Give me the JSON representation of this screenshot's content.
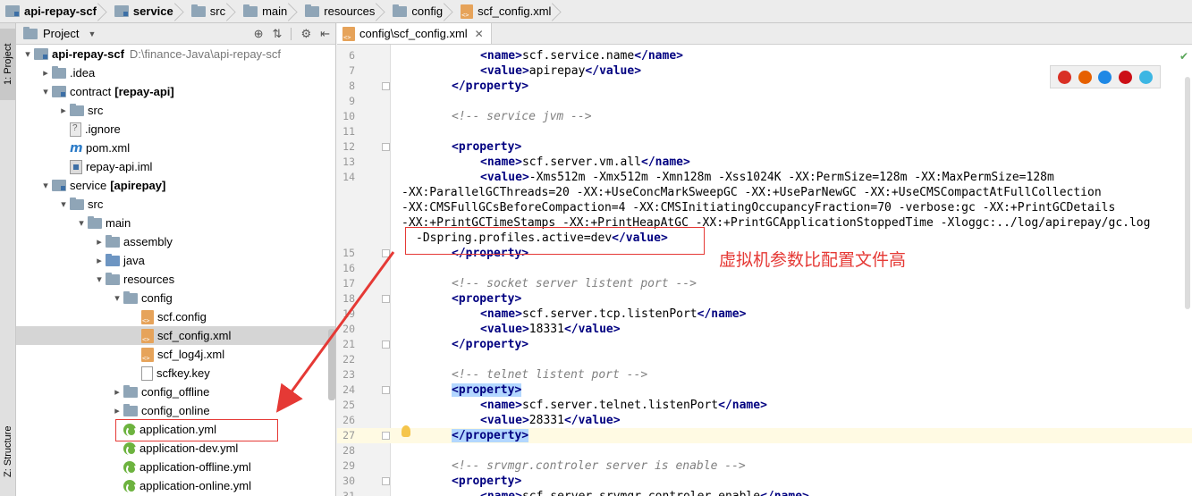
{
  "breadcrumb": [
    {
      "label": "api-repay-scf",
      "icon": "module-icon",
      "bold": true
    },
    {
      "label": "service",
      "icon": "module-icon",
      "bold": true
    },
    {
      "label": "src",
      "icon": "folder-icon",
      "bold": false
    },
    {
      "label": "main",
      "icon": "folder-icon",
      "bold": false
    },
    {
      "label": "resources",
      "icon": "resources-folder-icon",
      "bold": false
    },
    {
      "label": "config",
      "icon": "folder-icon",
      "bold": false
    },
    {
      "label": "scf_config.xml",
      "icon": "xml-file-icon",
      "bold": false
    }
  ],
  "tool_windows": {
    "project": "1: Project",
    "structure": "Z: Structure"
  },
  "project_panel": {
    "title": "Project",
    "tree": [
      {
        "depth": 0,
        "expand": "down",
        "icon": "module",
        "label": "api-repay-scf",
        "bold": true,
        "path": "D:\\finance-Java\\api-repay-scf"
      },
      {
        "depth": 1,
        "expand": "right",
        "icon": "folder",
        "label": ".idea"
      },
      {
        "depth": 1,
        "expand": "down",
        "icon": "module",
        "label": "contract",
        "suffix": "[repay-api]"
      },
      {
        "depth": 2,
        "expand": "right",
        "icon": "folder",
        "label": "src"
      },
      {
        "depth": 2,
        "expand": "none",
        "icon": "ignore",
        "label": ".ignore"
      },
      {
        "depth": 2,
        "expand": "none",
        "icon": "maven",
        "label": "pom.xml"
      },
      {
        "depth": 2,
        "expand": "none",
        "icon": "iml",
        "label": "repay-api.iml"
      },
      {
        "depth": 1,
        "expand": "down",
        "icon": "module",
        "label": "service",
        "suffix": "[apirepay]"
      },
      {
        "depth": 2,
        "expand": "down",
        "icon": "folder",
        "label": "src"
      },
      {
        "depth": 3,
        "expand": "down",
        "icon": "folder",
        "label": "main"
      },
      {
        "depth": 4,
        "expand": "right",
        "icon": "folder",
        "label": "assembly"
      },
      {
        "depth": 4,
        "expand": "right",
        "icon": "folder-blue",
        "label": "java"
      },
      {
        "depth": 4,
        "expand": "down",
        "icon": "folder-res",
        "label": "resources"
      },
      {
        "depth": 5,
        "expand": "down",
        "icon": "folder",
        "label": "config"
      },
      {
        "depth": 6,
        "expand": "none",
        "icon": "xml",
        "label": "scf.config"
      },
      {
        "depth": 6,
        "expand": "none",
        "icon": "xml",
        "label": "scf_config.xml",
        "selected": true
      },
      {
        "depth": 6,
        "expand": "none",
        "icon": "xml",
        "label": "scf_log4j.xml"
      },
      {
        "depth": 6,
        "expand": "none",
        "icon": "file",
        "label": "scfkey.key"
      },
      {
        "depth": 5,
        "expand": "right",
        "icon": "folder",
        "label": "config_offline"
      },
      {
        "depth": 5,
        "expand": "right",
        "icon": "folder",
        "label": "config_online"
      },
      {
        "depth": 5,
        "expand": "none",
        "icon": "yml",
        "label": "application.yml"
      },
      {
        "depth": 5,
        "expand": "none",
        "icon": "yml",
        "label": "application-dev.yml"
      },
      {
        "depth": 5,
        "expand": "none",
        "icon": "yml",
        "label": "application-offline.yml"
      },
      {
        "depth": 5,
        "expand": "none",
        "icon": "yml",
        "label": "application-online.yml"
      }
    ]
  },
  "editor": {
    "tab_label": "config\\scf_config.xml",
    "lines": [
      {
        "n": "6",
        "indent": 2,
        "parts": [
          [
            "tag",
            "<name>"
          ],
          [
            "val",
            "scf.service.name"
          ],
          [
            "tag",
            "</name>"
          ]
        ]
      },
      {
        "n": "7",
        "indent": 2,
        "parts": [
          [
            "tag",
            "<value>"
          ],
          [
            "val",
            "apirepay"
          ],
          [
            "tag",
            "</value>"
          ]
        ]
      },
      {
        "n": "8",
        "indent": 1,
        "parts": [
          [
            "tag",
            "</property>"
          ]
        ]
      },
      {
        "n": "9",
        "indent": 0,
        "parts": []
      },
      {
        "n": "10",
        "indent": 1,
        "parts": [
          [
            "cmt",
            "<!-- service jvm -->"
          ]
        ]
      },
      {
        "n": "11",
        "indent": 0,
        "parts": []
      },
      {
        "n": "12",
        "indent": 1,
        "parts": [
          [
            "tag",
            "<property>"
          ]
        ]
      },
      {
        "n": "13",
        "indent": 2,
        "parts": [
          [
            "tag",
            "<name>"
          ],
          [
            "val",
            "scf.server.vm.all"
          ],
          [
            "tag",
            "</name>"
          ]
        ]
      },
      {
        "n": "14",
        "indent": 2,
        "parts": [
          [
            "tag",
            "<value>"
          ],
          [
            "val",
            "-Xms512m -Xmx512m -Xmn128m -Xss1024K -XX:PermSize=128m -XX:MaxPermSize=128m"
          ]
        ]
      },
      {
        "n": "",
        "indent": -1,
        "parts": [
          [
            "val",
            "-XX:ParallelGCThreads=20 -XX:+UseConcMarkSweepGC -XX:+UseParNewGC -XX:+UseCMSCompactAtFullCollection"
          ]
        ]
      },
      {
        "n": "",
        "indent": -1,
        "parts": [
          [
            "val",
            "-XX:CMSFullGCsBeforeCompaction=4 -XX:CMSInitiatingOccupancyFraction=70 -verbose:gc -XX:+PrintGCDetails"
          ]
        ]
      },
      {
        "n": "",
        "indent": -1,
        "parts": [
          [
            "val",
            "-XX:+PrintGCTimeStamps -XX:+PrintHeapAtGC -XX:+PrintGCApplicationStoppedTime -Xloggc:../log/apirepay/gc.log"
          ]
        ]
      },
      {
        "n": "",
        "indent": -0.5,
        "parts": [
          [
            "val",
            "-Dspring.profiles.active=dev"
          ],
          [
            "tag",
            "</value>"
          ]
        ]
      },
      {
        "n": "15",
        "indent": 1,
        "parts": [
          [
            "tag",
            "</property>"
          ]
        ]
      },
      {
        "n": "16",
        "indent": 0,
        "parts": []
      },
      {
        "n": "17",
        "indent": 1,
        "parts": [
          [
            "cmt",
            "<!-- socket server listent port -->"
          ]
        ]
      },
      {
        "n": "18",
        "indent": 1,
        "parts": [
          [
            "tag",
            "<property>"
          ]
        ]
      },
      {
        "n": "19",
        "indent": 2,
        "parts": [
          [
            "tag",
            "<name>"
          ],
          [
            "val",
            "scf.server.tcp.listenPort"
          ],
          [
            "tag",
            "</name>"
          ]
        ]
      },
      {
        "n": "20",
        "indent": 2,
        "parts": [
          [
            "tag",
            "<value>"
          ],
          [
            "val",
            "18331"
          ],
          [
            "tag",
            "</value>"
          ]
        ]
      },
      {
        "n": "21",
        "indent": 1,
        "parts": [
          [
            "tag",
            "</property>"
          ]
        ]
      },
      {
        "n": "22",
        "indent": 0,
        "parts": []
      },
      {
        "n": "23",
        "indent": 1,
        "parts": [
          [
            "cmt",
            "<!-- telnet listent port -->"
          ]
        ]
      },
      {
        "n": "24",
        "indent": 1,
        "parts": [
          [
            "taghl",
            "<property>"
          ]
        ]
      },
      {
        "n": "25",
        "indent": 2,
        "parts": [
          [
            "tag",
            "<name>"
          ],
          [
            "val",
            "scf.server.telnet.listenPort"
          ],
          [
            "tag",
            "</name>"
          ]
        ]
      },
      {
        "n": "26",
        "indent": 2,
        "parts": [
          [
            "tag",
            "<value>"
          ],
          [
            "val",
            "28331"
          ],
          [
            "tag",
            "</value>"
          ]
        ]
      },
      {
        "n": "27",
        "indent": 1,
        "current": true,
        "parts": [
          [
            "taghl",
            "</property>"
          ]
        ]
      },
      {
        "n": "28",
        "indent": 0,
        "parts": []
      },
      {
        "n": "29",
        "indent": 1,
        "parts": [
          [
            "cmt",
            "<!-- srvmgr.controler server is enable -->"
          ]
        ]
      },
      {
        "n": "30",
        "indent": 1,
        "parts": [
          [
            "tag",
            "<property>"
          ]
        ]
      },
      {
        "n": "31",
        "indent": 2,
        "parts": [
          [
            "tag",
            "<name>"
          ],
          [
            "val",
            "scf.server.srvmgr.controler.enable"
          ],
          [
            "tag",
            "</name>"
          ]
        ]
      }
    ]
  },
  "browser_icons": [
    {
      "name": "chrome-icon",
      "color": "#d93025"
    },
    {
      "name": "firefox-icon",
      "color": "#e66000"
    },
    {
      "name": "safari-icon",
      "color": "#1e88e5"
    },
    {
      "name": "opera-icon",
      "color": "#cc0f16"
    },
    {
      "name": "ie-icon",
      "color": "#3cb6e3"
    }
  ],
  "annotation": {
    "text": "虚拟机参数比配置文件高",
    "color": "#e53935"
  }
}
